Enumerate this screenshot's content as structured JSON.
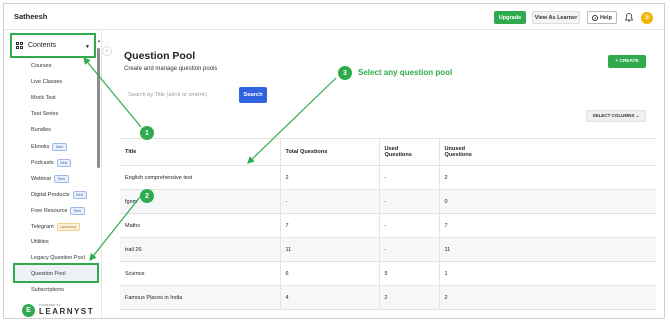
{
  "topbar": {
    "brand": "Satheesh",
    "upgrade_label": "Upgrade",
    "view_as_learner_label": "View As Learner",
    "help_label": "Help",
    "avatar_initial": "S"
  },
  "sidebar": {
    "contents_label": "Contents",
    "items": [
      {
        "label": "Courses",
        "badge": ""
      },
      {
        "label": "Live Classes",
        "badge": ""
      },
      {
        "label": "Mock Test",
        "badge": ""
      },
      {
        "label": "Test Series",
        "badge": ""
      },
      {
        "label": "Bundles",
        "badge": ""
      },
      {
        "label": "Ebooks",
        "badge": "New"
      },
      {
        "label": "Podcasts",
        "badge": "New"
      },
      {
        "label": "Webinar",
        "badge": "New"
      },
      {
        "label": "Digital Products",
        "badge": "New"
      },
      {
        "label": "Free Resource",
        "badge": "New"
      },
      {
        "label": "Telegram",
        "badge": "Upcoming"
      },
      {
        "label": "Utilities",
        "badge": ""
      },
      {
        "label": "Legacy Question Pool",
        "badge": ""
      },
      {
        "label": "Question Pool",
        "badge": ""
      },
      {
        "label": "Subscriptions",
        "badge": ""
      }
    ],
    "footer": {
      "powered_by": "POWERED BY",
      "logo_text": "LEARNYST",
      "logo_initial": "E"
    }
  },
  "main": {
    "title": "Question Pool",
    "subtitle": "Create and manage question pools",
    "create_label": "+ CREATE",
    "search_placeholder": "Search by Title (alt+k or cmd+k)",
    "search_button": "Search",
    "select_columns_label": "SELECT COLUMNS ⌄",
    "table": {
      "headers": [
        "Title",
        "Total Questions",
        "Used\nQuestions",
        "Unused\nQuestions"
      ],
      "rows": [
        [
          "English comprehensive test",
          "2",
          "-",
          "2"
        ],
        [
          "fgnm",
          "-",
          "-",
          "0"
        ],
        [
          "Maths",
          "7",
          "-",
          "7"
        ],
        [
          "trail 26",
          "11",
          "-",
          "11"
        ],
        [
          "Science",
          "6",
          "5",
          "1"
        ],
        [
          "Famous Places in India",
          "4",
          "2",
          "2"
        ]
      ]
    }
  },
  "annotations": {
    "step1": "1",
    "step2": "2",
    "step3": "3",
    "step3_label": "Select any question pool",
    "accent_color": "#2fab4d"
  }
}
